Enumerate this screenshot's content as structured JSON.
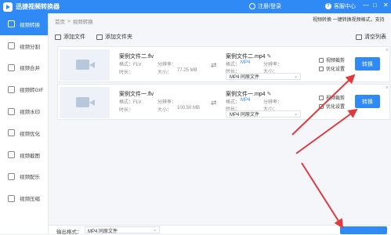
{
  "titlebar": {
    "app_title": "迅捷视频转换器",
    "login": "注册/登录",
    "help": "客服中心",
    "minimize": "—",
    "maximize": "□",
    "close": "✕"
  },
  "sidebar": {
    "items": [
      {
        "label": "视频转换",
        "icon": "video-convert-icon",
        "active": true
      },
      {
        "label": "视频分割",
        "icon": "split-icon"
      },
      {
        "label": "视频合并",
        "icon": "merge-icon"
      },
      {
        "label": "视频转GIF",
        "icon": "gif-icon"
      },
      {
        "label": "视频水印",
        "icon": "watermark-icon"
      },
      {
        "label": "视频优化",
        "icon": "optimize-icon"
      },
      {
        "label": "视频截图",
        "icon": "screenshot-icon"
      },
      {
        "label": "视频配乐",
        "icon": "music-icon"
      },
      {
        "label": "视频压缩",
        "icon": "compress-icon"
      }
    ]
  },
  "breadcrumb": {
    "home": "首页",
    "sep": ">",
    "current": "视频转换"
  },
  "tagline": "视频转换  一键转换视频格式，支持",
  "toolbar": {
    "add_file": "添加文件",
    "add_folder": "添加文件夹",
    "clear_list": "清空列表"
  },
  "files": [
    {
      "src_name": "案例文件二.flv",
      "src_format_label": "格式：FLV",
      "src_res_label": "分辨率：",
      "src_duration_label": "时长：",
      "src_size_label": "大小：",
      "src_size": "77.25 MB",
      "dst_name": "案例文件二.mp4",
      "dst_format_label": "格式：",
      "dst_format": "MP4",
      "dst_res_label": "分辨率：",
      "dst_duration_label": "时长：",
      "dst_size_label": "大小：",
      "select_value": "MP4  同原文件",
      "opt_crop": "视频裁剪",
      "opt_optimize": "优化设置",
      "convert": "转换",
      "close": "×"
    },
    {
      "src_name": "案例文件一.flv",
      "src_format_label": "格式：FLV",
      "src_res_label": "分辨率：",
      "src_duration_label": "时长：",
      "src_size_label": "大小：",
      "src_size": "100.50 MB",
      "dst_name": "案例文件一.mp4",
      "dst_format_label": "格式：",
      "dst_format": "MP4",
      "dst_res_label": "分辨率：",
      "dst_duration_label": "时长：",
      "dst_size_label": "大小：",
      "select_value": "MP4  同原文件",
      "opt_crop": "视频裁剪",
      "opt_optimize": "优化设置",
      "convert": "转换",
      "close": "×"
    }
  ],
  "bottom": {
    "output_label": "输出格式：",
    "output_value": "MP4  同原文件"
  },
  "annotation": {
    "arrow_color": "#e0393e"
  }
}
